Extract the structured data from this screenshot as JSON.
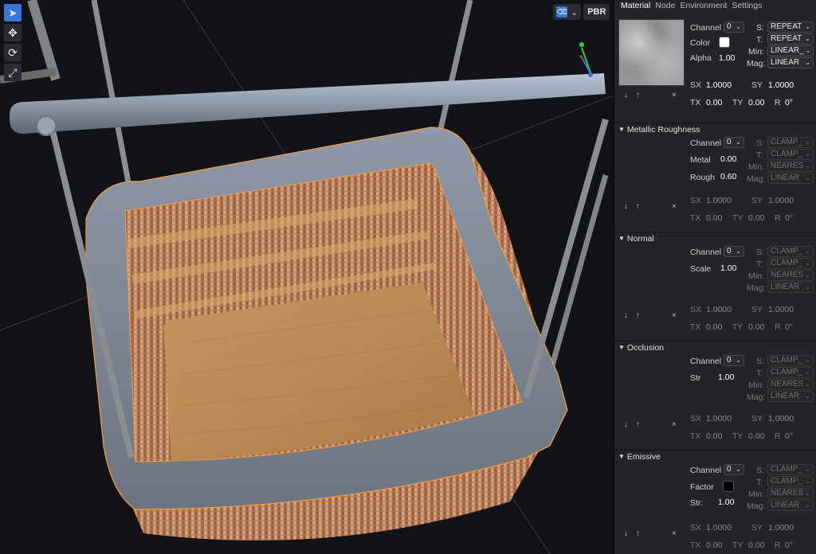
{
  "toolbar": {
    "tools": [
      {
        "name": "select-icon",
        "glyph": "➤",
        "active": true
      },
      {
        "name": "move-icon",
        "glyph": "✥",
        "active": false
      },
      {
        "name": "rotate-icon",
        "glyph": "⟳",
        "active": false
      },
      {
        "name": "scale-icon",
        "glyph": "⤢",
        "active": false
      }
    ]
  },
  "viewport": {
    "shading_icon": "eraser-icon",
    "shading_chevron": "⌄",
    "pbr_label": "PBR",
    "gizmo_colors": {
      "x": "#e23b3b",
      "y": "#3ad13a",
      "z": "#3a6ee0"
    }
  },
  "panel": {
    "tabs": [
      "Material",
      "Node",
      "Environment",
      "Settings"
    ],
    "active_tab": "Material",
    "base": {
      "channel_label": "Channel",
      "channel_value": "0",
      "color_label": "Color",
      "color_value": "#ffffff",
      "alpha_label": "Alpha",
      "alpha_value": "1.00",
      "s_label": "S:",
      "s_value": "REPEAT",
      "t_label": "T:",
      "t_value": "REPEAT",
      "min_label": "Min:",
      "min_value": "LINEAR_",
      "mag_label": "Mag:",
      "mag_value": "LINEAR",
      "sx_label": "SX",
      "sx_value": "1.0000",
      "sy_label": "SY",
      "sy_value": "1.0000",
      "tx_label": "TX",
      "tx_value": "0.00",
      "ty_label": "TY",
      "ty_value": "0.00",
      "r_label": "R",
      "r_value": "0°"
    },
    "sections": [
      {
        "id": "metallic-roughness",
        "title": "Metallic Roughness",
        "channel_label": "Channel",
        "channel_value": "0",
        "props": [
          {
            "label": "Metal",
            "value": "0.00"
          },
          {
            "label": "Rough",
            "value": "0.60"
          }
        ],
        "s_value": "CLAMP_",
        "t_value": "CLAMP_",
        "min_value": "NEARES",
        "mag_value": "LINEAR",
        "sx_value": "1.0000",
        "sy_value": "1.0000",
        "tx_value": "0.00",
        "ty_value": "0.00",
        "r_value": "0°"
      },
      {
        "id": "normal",
        "title": "Normal",
        "channel_label": "Channel",
        "channel_value": "0",
        "props": [
          {
            "label": "Scale",
            "value": "1.00"
          }
        ],
        "s_value": "CLAMP_",
        "t_value": "CLAMP_",
        "min_value": "NEARES",
        "mag_value": "LINEAR",
        "sx_value": "1.0000",
        "sy_value": "1.0000",
        "tx_value": "0.00",
        "ty_value": "0.00",
        "r_value": "0°"
      },
      {
        "id": "occlusion",
        "title": "Occlusion",
        "channel_label": "Channel",
        "channel_value": "0",
        "props": [
          {
            "label": "Str",
            "value": "1.00"
          }
        ],
        "s_value": "CLAMP_",
        "t_value": "CLAMP_",
        "min_value": "NEARES",
        "mag_value": "LINEAR",
        "sx_value": "1.0000",
        "sy_value": "1.0000",
        "tx_value": "0.00",
        "ty_value": "0.00",
        "r_value": "0°"
      },
      {
        "id": "emissive",
        "title": "Emissive",
        "channel_label": "Channel",
        "channel_value": "0",
        "factor_label": "Factor",
        "factor_color": "#000000",
        "props": [
          {
            "label": "Str:",
            "value": "1.00"
          }
        ],
        "s_value": "CLAMP_",
        "t_value": "CLAMP_",
        "min_value": "NEARES",
        "mag_value": "LINEAR",
        "sx_value": "1.0000",
        "sy_value": "1.0000",
        "tx_value": "0.00",
        "ty_value": "0.00",
        "r_value": "0°"
      }
    ],
    "common": {
      "s_label": "S:",
      "t_label": "T:",
      "min_label": "Min:",
      "mag_label": "Mag:",
      "sx_label": "SX",
      "sy_label": "SY",
      "tx_label": "TX",
      "ty_label": "TY",
      "r_label": "R",
      "down_icon": "↓",
      "up_icon": "↑",
      "close_icon": "×"
    }
  }
}
